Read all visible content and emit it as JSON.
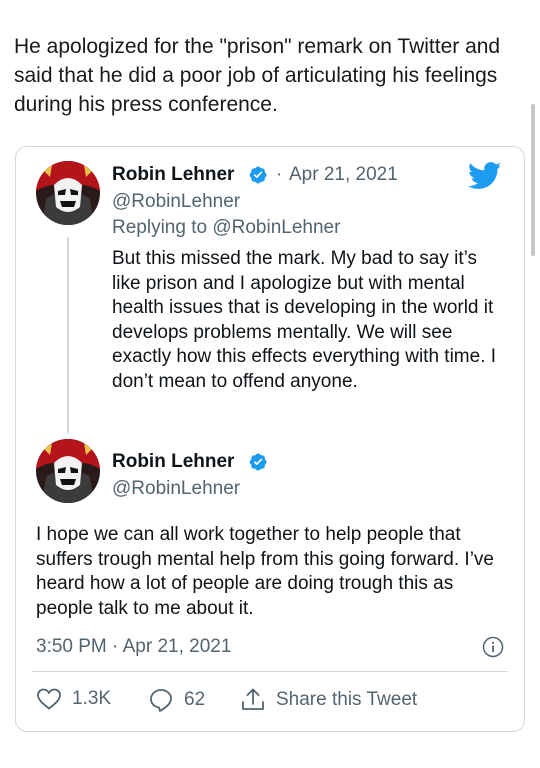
{
  "intro_text": "He apologized for the \"prison\" remark on Twitter and said that he did a poor job of articulating his feelings during his press conference.",
  "reply_tweet": {
    "author_name": "Robin Lehner",
    "handle": "@RobinLehner",
    "separator": "·",
    "date": "Apr 21, 2021",
    "replying_to_label": "Replying to",
    "replying_to_handle": "@RobinLehner",
    "text": "But this missed the mark. My bad to say it’s like prison and I apologize but with mental health issues that is developing in the world it develops problems mentally. We will see exactly how this effects everything with time. I don’t mean to offend anyone."
  },
  "main_tweet": {
    "author_name": "Robin Lehner",
    "handle": "@RobinLehner",
    "text": "I hope we can all work together to help people that suffers trough mental help from this going forward. I’ve heard how a lot of people are doing trough this as people talk to me about it.",
    "timestamp": "3:50 PM · Apr 21, 2021"
  },
  "actions": {
    "likes": "1.3K",
    "replies": "62",
    "share_label": "Share this Tweet"
  },
  "icons": {
    "verified": "verified-badge-icon",
    "twitter": "twitter-bird-icon",
    "info": "info-icon",
    "like": "heart-icon",
    "reply": "speech-bubble-icon",
    "share": "share-upload-icon"
  },
  "colors": {
    "twitter_blue": "#1d9bf0",
    "secondary_text": "#536471",
    "border": "#cfd9de",
    "avatar_red": "#c0161d"
  }
}
